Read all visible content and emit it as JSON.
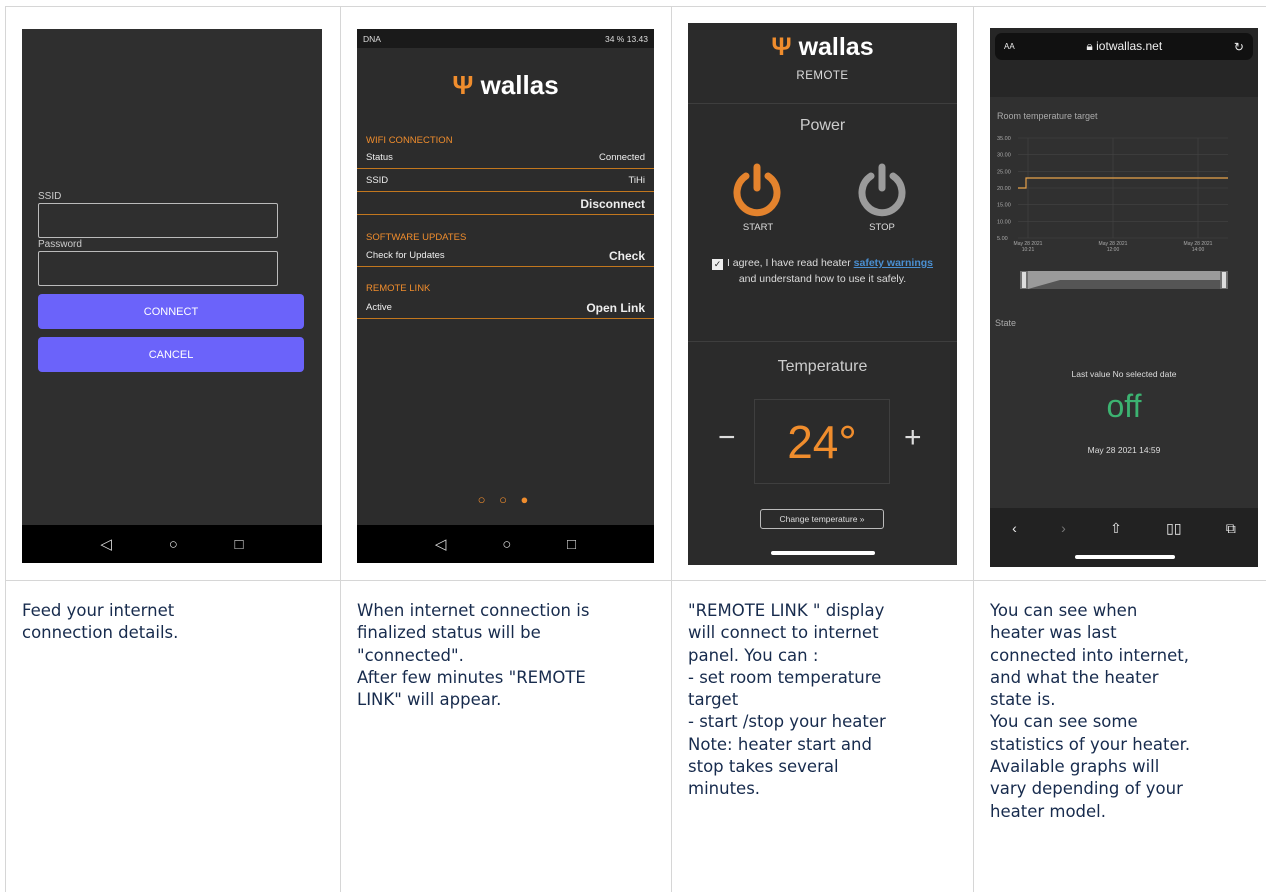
{
  "captions": [
    "Feed your internet\nconnection details.",
    "When internet connection is\nfinalized status will be\n\"connected\".\nAfter few minutes \"REMOTE\nLINK\" will appear.",
    "\"REMOTE LINK \" display\nwill connect to internet\npanel. You can :\n- set room temperature\ntarget\n- start /stop your heater\nNote: heater start and\nstop takes several\nminutes.",
    "You can see when\nheater was last\nconnected into internet,\nand what the heater\nstate is.\nYou can see some\nstatistics of your heater.\nAvailable graphs will\nvary depending of your\nheater model."
  ],
  "screen1": {
    "ssid_label": "SSID",
    "password_label": "Password",
    "connect": "CONNECT",
    "cancel": "CANCEL"
  },
  "screen2": {
    "status_left": "DNA",
    "status_right": "34 %  13.43",
    "brand": "wallas",
    "wifi_header": "WIFI CONNECTION",
    "status_label": "Status",
    "status_value": "Connected",
    "ssid_label": "SSID",
    "ssid_value": "TiHi",
    "disconnect": "Disconnect",
    "updates_header": "SOFTWARE UPDATES",
    "check_label": "Check for Updates",
    "check": "Check",
    "remote_header": "REMOTE LINK",
    "active_label": "Active",
    "open_link": "Open Link",
    "pager": "○ ○ ●"
  },
  "screen3": {
    "brand": "wallas",
    "remote": "REMOTE",
    "power": "Power",
    "start": "START",
    "stop": "STOP",
    "agree_pre": "I agree, I have read heater",
    "agree_link": "safety warnings",
    "agree_post": "and understand how to use it safely.",
    "temperature": "Temperature",
    "minus": "−",
    "value": "24°",
    "plus": "+",
    "change": "Change temperature »"
  },
  "screen4": {
    "aa": "AA",
    "url": "iotwallas.net",
    "chart_title": "Room temperature target",
    "state_label": "State",
    "last_value": "Last value No selected date",
    "state_value": "off",
    "timestamp": "May 28 2021 14:59"
  },
  "chart_data": {
    "type": "line",
    "title": "Room temperature target",
    "y_ticks": [
      "35.00",
      "30.00",
      "25.00",
      "20.00",
      "15.00",
      "10.00",
      "5.00"
    ],
    "x_ticks": [
      "May 28 2021\n10:21",
      "May 28 2021\n12:00",
      "May 28 2021\n14:00"
    ],
    "ylim": [
      5,
      35
    ],
    "series": [
      {
        "values": [
          20,
          20,
          23,
          23,
          23
        ]
      }
    ],
    "grid": true
  }
}
